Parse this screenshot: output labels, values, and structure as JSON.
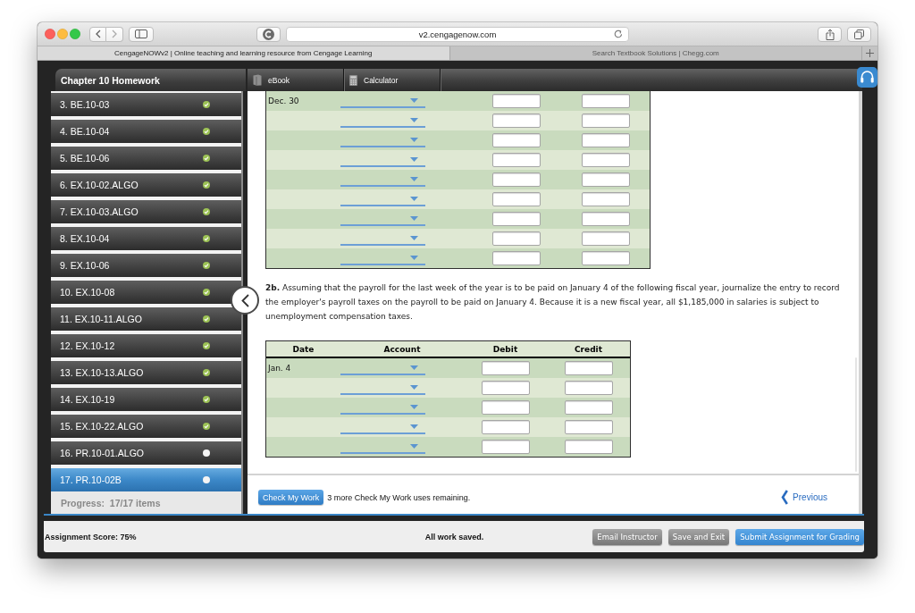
{
  "browser": {
    "url": "v2.cengagenow.com",
    "tabs": [
      {
        "title": "CengageNOWv2 | Online teaching and learning resource from Cengage Learning",
        "selected": true
      },
      {
        "title": "Search Textbook Solutions | Chegg.com",
        "selected": false
      }
    ]
  },
  "sidebar": {
    "title": "Chapter 10 Homework",
    "items": [
      {
        "label": "3. BE.10-03",
        "completed": true,
        "selected": false
      },
      {
        "label": "4. BE.10-04",
        "completed": true,
        "selected": false
      },
      {
        "label": "5. BE.10-06",
        "completed": true,
        "selected": false
      },
      {
        "label": "6. EX.10-02.ALGO",
        "completed": true,
        "selected": false
      },
      {
        "label": "7. EX.10-03.ALGO",
        "completed": true,
        "selected": false
      },
      {
        "label": "8. EX.10-04",
        "completed": true,
        "selected": false
      },
      {
        "label": "9. EX.10-06",
        "completed": true,
        "selected": false
      },
      {
        "label": "10. EX.10-08",
        "completed": true,
        "selected": false
      },
      {
        "label": "11. EX.10-11.ALGO",
        "completed": true,
        "selected": false
      },
      {
        "label": "12. EX.10-12",
        "completed": true,
        "selected": false
      },
      {
        "label": "13. EX.10-13.ALGO",
        "completed": true,
        "selected": false
      },
      {
        "label": "14. EX.10-19",
        "completed": true,
        "selected": false
      },
      {
        "label": "15. EX.10-22.ALGO",
        "completed": true,
        "selected": false
      },
      {
        "label": "16. PR.10-01.ALGO",
        "completed": false,
        "selected": false
      },
      {
        "label": "17. PR.10-02B",
        "completed": false,
        "selected": true
      }
    ],
    "progress": "Progress:  17/17 items"
  },
  "toolbar": {
    "tools": [
      {
        "label": "eBook",
        "kind": "book"
      },
      {
        "label": "Calculator",
        "kind": "calculator"
      }
    ]
  },
  "question": {
    "journal_upper": {
      "rows": [
        {
          "date": "Dec. 30"
        },
        {},
        {},
        {},
        {},
        {},
        {},
        {},
        {}
      ]
    },
    "prompt": "**2b.** Assuming that the payroll for the last week of the year is to be paid on January 4 of the following fiscal year, journalize the entry to record the employer's payroll taxes on the payroll to be paid on January 4. Because it is a new fiscal year, all $1,185,000 in salaries is subject to unemployment compensation taxes.",
    "journal": {
      "columns": [
        "Date",
        "Account",
        "Debit",
        "Credit"
      ],
      "rows": [
        {
          "date": "Jan. 4"
        },
        {},
        {},
        {},
        {}
      ]
    }
  },
  "footer": {
    "check_button": "Check My Work",
    "remaining": "3 more Check My Work uses remaining.",
    "previous": "Previous"
  },
  "status_bar": {
    "score": "Assignment Score: 75%",
    "save_state": "All work saved.",
    "buttons": [
      {
        "label": "Email Instructor",
        "kind": "secondary"
      },
      {
        "label": "Save and Exit",
        "kind": "secondary"
      },
      {
        "label": "Submit Assignment for Grading",
        "kind": "primary"
      }
    ]
  }
}
